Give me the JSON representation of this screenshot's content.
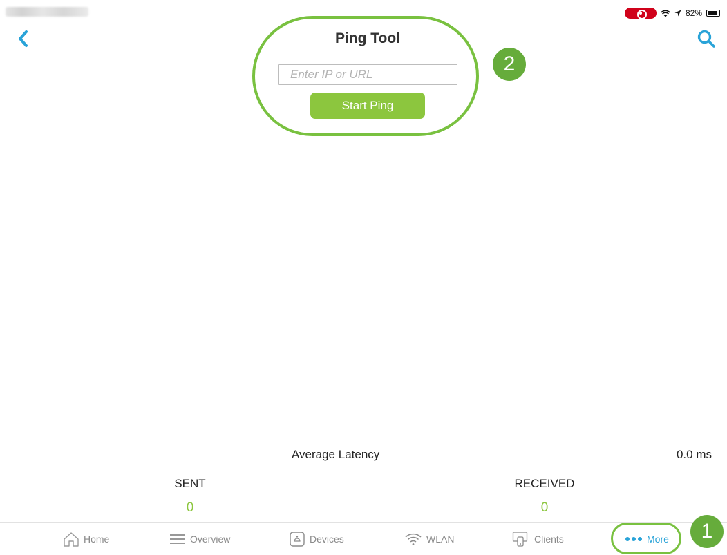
{
  "status_bar": {
    "battery_percent": "82%",
    "recording_color": "#d0021b"
  },
  "nav": {
    "back_icon": "chevron-left-icon",
    "search_icon": "search-icon",
    "accent_color": "#29a3d8"
  },
  "ping": {
    "title": "Ping Tool",
    "input_placeholder": "Enter IP or URL",
    "input_value": "",
    "start_label": "Start Ping",
    "button_color": "#8cc63e"
  },
  "stats": {
    "average_latency_label": "Average Latency",
    "average_latency_value": "0.0 ms",
    "sent_label": "SENT",
    "sent_value": "0",
    "received_label": "RECEIVED",
    "received_value": "0"
  },
  "tabs": [
    {
      "label": "Home",
      "icon": "home-icon",
      "active": false
    },
    {
      "label": "Overview",
      "icon": "menu-lines-icon",
      "active": false
    },
    {
      "label": "Devices",
      "icon": "device-icon",
      "active": false
    },
    {
      "label": "WLAN",
      "icon": "wifi-icon",
      "active": false
    },
    {
      "label": "Clients",
      "icon": "clients-icon",
      "active": false
    },
    {
      "label": "More",
      "icon": "more-dots-icon",
      "active": true
    }
  ],
  "annotations": {
    "step_1": "1",
    "step_2": "2",
    "highlight_color": "#79c140"
  }
}
